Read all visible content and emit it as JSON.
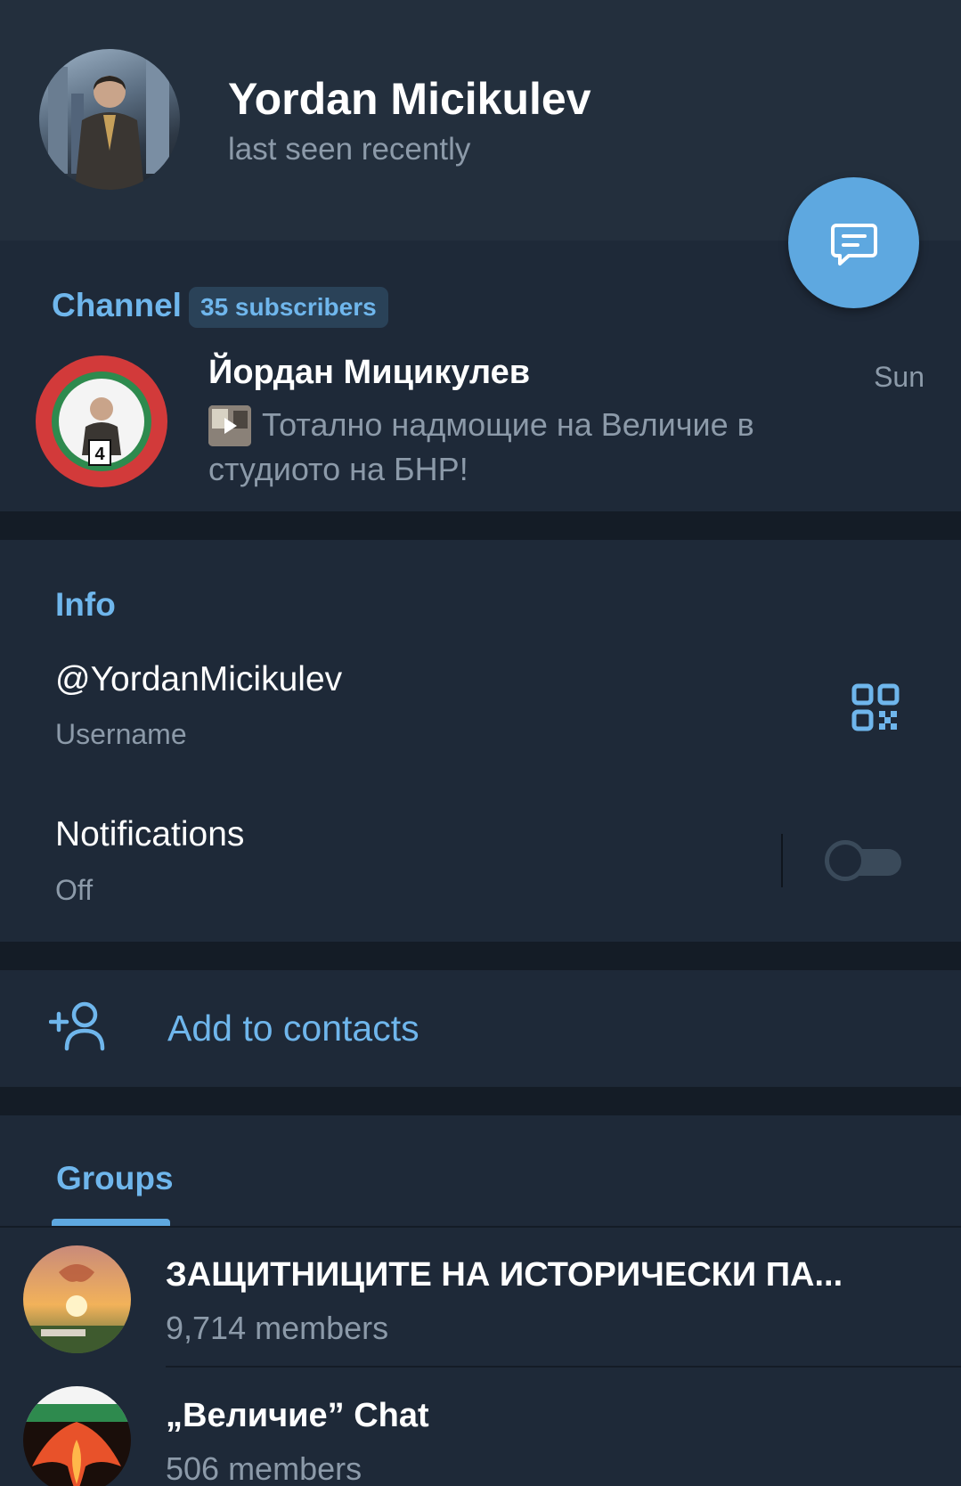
{
  "profile": {
    "name": "Yordan Micikulev",
    "status": "last seen recently"
  },
  "fab": {
    "icon": "message-icon"
  },
  "channel": {
    "label": "Channel",
    "subscribers": "35 subscribers",
    "title": "Йордан Мицикулев",
    "time": "Sun",
    "preview": "Тотално надмощие на Величие в студиото на БНР!",
    "avatar_number": "4"
  },
  "info": {
    "label": "Info",
    "username": "@YordanMicikulev",
    "username_caption": "Username",
    "notifications_label": "Notifications",
    "notifications_value": "Off",
    "notifications_enabled": false
  },
  "actions": {
    "add_to_contacts": "Add to contacts"
  },
  "groups": {
    "tab_label": "Groups",
    "items": [
      {
        "title": "ЗАЩИТНИЦИТЕ НА ИСТОРИЧЕСКИ ПА...",
        "members": "9,714 members"
      },
      {
        "title": "„Величие” Chat",
        "members": "506 members"
      }
    ]
  },
  "colors": {
    "accent": "#6fb6ec",
    "fab": "#5ea8e0",
    "background": "#1e2938",
    "header": "#232f3d",
    "secondary_text": "#8c9aa9"
  }
}
